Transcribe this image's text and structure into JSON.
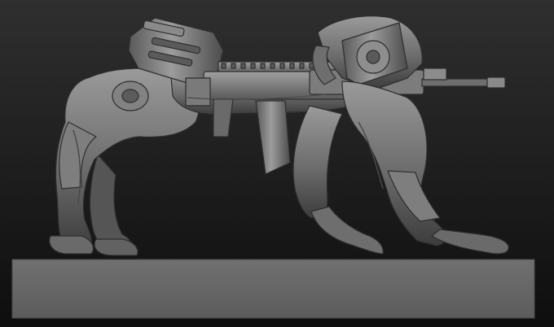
{
  "scene": {
    "subject": "robotic-quadruped-with-mounted-rifle-sculpt",
    "render_style": "clay-matcap-gray",
    "colors": {
      "background_top": "#2f2f2f",
      "background_bottom": "#0e0e0e",
      "clay_light": "#9a9a9a",
      "clay_mid": "#6c6c6c",
      "clay_dark": "#3c3c3c",
      "pedestal": "#666666"
    }
  }
}
